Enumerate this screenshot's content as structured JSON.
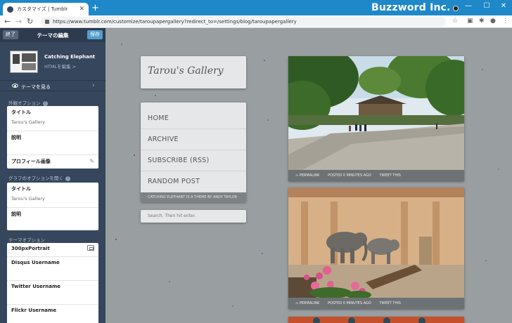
{
  "browser": {
    "tab_title": "カスタマイズ | Tumblr",
    "new_tab": "+",
    "url": "https://www.tumblr.com/customize/taroupapergallery?redirect_to=/settings/blog/taroupapergallery",
    "watermark": "Buzzword Inc."
  },
  "editor": {
    "exit_label": "終了",
    "title": "テーマの編集",
    "save_label": "保存",
    "theme_name": "Catching Elephant",
    "edit_html_label": "HTMLを編集 >",
    "view_theme_label": "テーマを見る",
    "appearance_head": "外観オプション",
    "appearance_fields": [
      {
        "label": "タイトル",
        "value": "Tarou's Gallery"
      },
      {
        "label": "説明",
        "value": ""
      },
      {
        "label": "プロフィール画像",
        "value": ""
      }
    ],
    "group_head": "グラフのオプションを開く",
    "group_fields": [
      {
        "label": "タイトル",
        "value": "Tarou's Gallery"
      },
      {
        "label": "説明",
        "value": ""
      }
    ],
    "theme_options_head": "テーマオプション",
    "theme_fields": [
      {
        "label": "300pxPortrait"
      },
      {
        "label": "Disqus Username"
      },
      {
        "label": "Twitter Username"
      },
      {
        "label": "Flickr Username"
      }
    ]
  },
  "blog": {
    "title": "Tarou's Gallery",
    "nav": [
      "HOME",
      "ARCHIVE",
      "SUBSCRIBE (RSS)",
      "RANDOM POST"
    ],
    "footer": "CATCHING ELEPHANT IS A THEME BY ANDY TAYLOR",
    "search_placeholder": "Search. Then hit enter.",
    "posts": [
      {
        "permalink": "∞ PERMALINK",
        "posted": "POSTED 0 MINUTES AGO",
        "tweet": "TWEET THIS"
      },
      {
        "permalink": "∞ PERMALINK",
        "posted": "POSTED 0 MINUTES AGO",
        "tweet": "TWEET THIS"
      }
    ]
  },
  "colors": {
    "sidebar": "#36465d",
    "titlebar": "#1e88c8",
    "save_button": "#529ecc",
    "preview_bg": "#999ea1"
  }
}
